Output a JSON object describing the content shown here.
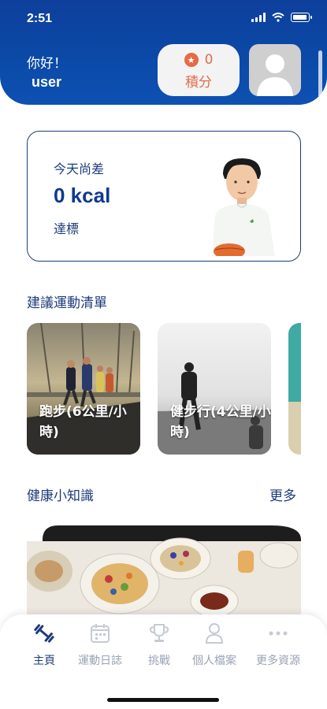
{
  "status": {
    "time": "2:51"
  },
  "header": {
    "greeting": "你好！",
    "username": "user",
    "points_value": "0",
    "points_label": "積分"
  },
  "goal_card": {
    "pre_text": "今天尚差",
    "kcal": "0 kcal",
    "post_text": "達標"
  },
  "exercise_section": {
    "title": "建議運動清單",
    "items": [
      {
        "label": "跑步(6公里/小時)"
      },
      {
        "label": "健步行(4公里/小時)"
      }
    ]
  },
  "tips_section": {
    "title": "健康小知識",
    "more": "更多"
  },
  "tabs": [
    {
      "label": "主頁",
      "icon": "dumbbell-icon",
      "active": true
    },
    {
      "label": "運動日誌",
      "icon": "calendar-icon",
      "active": false
    },
    {
      "label": "挑戰",
      "icon": "trophy-icon",
      "active": false
    },
    {
      "label": "個人檔案",
      "icon": "person-icon",
      "active": false
    },
    {
      "label": "更多資源",
      "icon": "more-dots-icon",
      "active": false
    }
  ],
  "colors": {
    "primary": "#0b4aa8",
    "accent": "#e36b4a",
    "text": "#1c3b7a"
  }
}
